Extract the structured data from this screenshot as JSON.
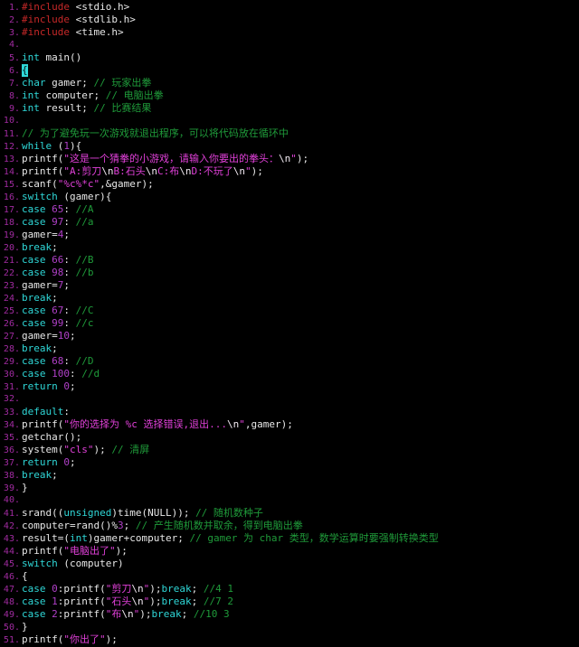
{
  "editor": {
    "name": "code-editor",
    "language": "C",
    "background_color": "#000000",
    "cursor": {
      "line": 6,
      "column": 1,
      "char": "{",
      "color": "#2fd7d7"
    },
    "colors": {
      "keyword": "#2fd7d7",
      "preprocessor": "#c62828",
      "number": "#b040c8",
      "string": "#e040d8",
      "comment": "#1f9b3a",
      "identifier": "#e8e8e8",
      "line_number": "#a02ba0",
      "background": "#000000"
    }
  },
  "lines": [
    {
      "n": "1",
      "tokens": [
        {
          "t": "pre",
          "v": "#include"
        },
        {
          "t": "id",
          "v": " "
        },
        {
          "t": "hdr",
          "v": "<stdio.h>"
        }
      ]
    },
    {
      "n": "2",
      "tokens": [
        {
          "t": "pre",
          "v": "#include"
        },
        {
          "t": "id",
          "v": " "
        },
        {
          "t": "hdr",
          "v": "<stdlib.h>"
        }
      ]
    },
    {
      "n": "3",
      "tokens": [
        {
          "t": "pre",
          "v": "#include"
        },
        {
          "t": "id",
          "v": " "
        },
        {
          "t": "hdr",
          "v": "<time.h>"
        }
      ]
    },
    {
      "n": "4",
      "tokens": []
    },
    {
      "n": "5",
      "tokens": [
        {
          "t": "kw",
          "v": "int"
        },
        {
          "t": "id",
          "v": " main()"
        }
      ]
    },
    {
      "n": "6",
      "tokens": [
        {
          "t": "cursor",
          "v": "{"
        }
      ]
    },
    {
      "n": "7",
      "tokens": [
        {
          "t": "kw",
          "v": "char"
        },
        {
          "t": "id",
          "v": " gamer; "
        },
        {
          "t": "cmt",
          "v": "// 玩家出拳"
        }
      ]
    },
    {
      "n": "8",
      "tokens": [
        {
          "t": "kw",
          "v": "int"
        },
        {
          "t": "id",
          "v": " computer; "
        },
        {
          "t": "cmt",
          "v": "// 电脑出拳"
        }
      ]
    },
    {
      "n": "9",
      "tokens": [
        {
          "t": "kw",
          "v": "int"
        },
        {
          "t": "id",
          "v": " result; "
        },
        {
          "t": "cmt",
          "v": "// 比赛结果"
        }
      ]
    },
    {
      "n": "10",
      "tokens": []
    },
    {
      "n": "11",
      "tokens": [
        {
          "t": "cmt",
          "v": "// 为了避免玩一次游戏就退出程序，可以将代码放在循环中"
        }
      ]
    },
    {
      "n": "12",
      "tokens": [
        {
          "t": "kw",
          "v": "while"
        },
        {
          "t": "id",
          "v": " ("
        },
        {
          "t": "num",
          "v": "1"
        },
        {
          "t": "id",
          "v": "){"
        }
      ]
    },
    {
      "n": "13",
      "tokens": [
        {
          "t": "id",
          "v": "printf("
        },
        {
          "t": "str",
          "v": "\"这是一个猜拳的小游戏，请输入你要出的拳头："
        },
        {
          "t": "esc",
          "v": "\\n"
        },
        {
          "t": "str",
          "v": "\""
        },
        {
          "t": "id",
          "v": ");"
        }
      ]
    },
    {
      "n": "14",
      "tokens": [
        {
          "t": "id",
          "v": "printf("
        },
        {
          "t": "str",
          "v": "\"A:剪刀"
        },
        {
          "t": "esc",
          "v": "\\n"
        },
        {
          "t": "str",
          "v": "B:石头"
        },
        {
          "t": "esc",
          "v": "\\n"
        },
        {
          "t": "str",
          "v": "C:布"
        },
        {
          "t": "esc",
          "v": "\\n"
        },
        {
          "t": "str",
          "v": "D:不玩了"
        },
        {
          "t": "esc",
          "v": "\\n"
        },
        {
          "t": "str",
          "v": "\""
        },
        {
          "t": "id",
          "v": ");"
        }
      ]
    },
    {
      "n": "15",
      "tokens": [
        {
          "t": "id",
          "v": "scanf("
        },
        {
          "t": "str",
          "v": "\"%c%*c\""
        },
        {
          "t": "id",
          "v": ",&gamer);"
        }
      ]
    },
    {
      "n": "16",
      "tokens": [
        {
          "t": "kw",
          "v": "switch"
        },
        {
          "t": "id",
          "v": " (gamer){"
        }
      ]
    },
    {
      "n": "17",
      "tokens": [
        {
          "t": "kw",
          "v": "case"
        },
        {
          "t": "id",
          "v": " "
        },
        {
          "t": "num",
          "v": "65"
        },
        {
          "t": "id",
          "v": ": "
        },
        {
          "t": "cmt",
          "v": "//A"
        }
      ]
    },
    {
      "n": "18",
      "tokens": [
        {
          "t": "kw",
          "v": "case"
        },
        {
          "t": "id",
          "v": " "
        },
        {
          "t": "num",
          "v": "97"
        },
        {
          "t": "id",
          "v": ": "
        },
        {
          "t": "cmt",
          "v": "//a"
        }
      ]
    },
    {
      "n": "19",
      "tokens": [
        {
          "t": "id",
          "v": "gamer="
        },
        {
          "t": "num",
          "v": "4"
        },
        {
          "t": "id",
          "v": ";"
        }
      ]
    },
    {
      "n": "20",
      "tokens": [
        {
          "t": "kw",
          "v": "break"
        },
        {
          "t": "id",
          "v": ";"
        }
      ]
    },
    {
      "n": "21",
      "tokens": [
        {
          "t": "kw",
          "v": "case"
        },
        {
          "t": "id",
          "v": " "
        },
        {
          "t": "num",
          "v": "66"
        },
        {
          "t": "id",
          "v": ": "
        },
        {
          "t": "cmt",
          "v": "//B"
        }
      ]
    },
    {
      "n": "22",
      "tokens": [
        {
          "t": "kw",
          "v": "case"
        },
        {
          "t": "id",
          "v": " "
        },
        {
          "t": "num",
          "v": "98"
        },
        {
          "t": "id",
          "v": ": "
        },
        {
          "t": "cmt",
          "v": "//b"
        }
      ]
    },
    {
      "n": "23",
      "tokens": [
        {
          "t": "id",
          "v": "gamer="
        },
        {
          "t": "num",
          "v": "7"
        },
        {
          "t": "id",
          "v": ";"
        }
      ]
    },
    {
      "n": "24",
      "tokens": [
        {
          "t": "kw",
          "v": "break"
        },
        {
          "t": "id",
          "v": ";"
        }
      ]
    },
    {
      "n": "25",
      "tokens": [
        {
          "t": "kw",
          "v": "case"
        },
        {
          "t": "id",
          "v": " "
        },
        {
          "t": "num",
          "v": "67"
        },
        {
          "t": "id",
          "v": ": "
        },
        {
          "t": "cmt",
          "v": "//C"
        }
      ]
    },
    {
      "n": "26",
      "tokens": [
        {
          "t": "kw",
          "v": "case"
        },
        {
          "t": "id",
          "v": " "
        },
        {
          "t": "num",
          "v": "99"
        },
        {
          "t": "id",
          "v": ": "
        },
        {
          "t": "cmt",
          "v": "//c"
        }
      ]
    },
    {
      "n": "27",
      "tokens": [
        {
          "t": "id",
          "v": "gamer="
        },
        {
          "t": "num",
          "v": "10"
        },
        {
          "t": "id",
          "v": ";"
        }
      ]
    },
    {
      "n": "28",
      "tokens": [
        {
          "t": "kw",
          "v": "break"
        },
        {
          "t": "id",
          "v": ";"
        }
      ]
    },
    {
      "n": "29",
      "tokens": [
        {
          "t": "kw",
          "v": "case"
        },
        {
          "t": "id",
          "v": " "
        },
        {
          "t": "num",
          "v": "68"
        },
        {
          "t": "id",
          "v": ": "
        },
        {
          "t": "cmt",
          "v": "//D"
        }
      ]
    },
    {
      "n": "30",
      "tokens": [
        {
          "t": "kw",
          "v": "case"
        },
        {
          "t": "id",
          "v": " "
        },
        {
          "t": "num",
          "v": "100"
        },
        {
          "t": "id",
          "v": ": "
        },
        {
          "t": "cmt",
          "v": "//d"
        }
      ]
    },
    {
      "n": "31",
      "tokens": [
        {
          "t": "kw",
          "v": "return"
        },
        {
          "t": "id",
          "v": " "
        },
        {
          "t": "num",
          "v": "0"
        },
        {
          "t": "id",
          "v": ";"
        }
      ]
    },
    {
      "n": "32",
      "tokens": []
    },
    {
      "n": "33",
      "tokens": [
        {
          "t": "kw",
          "v": "default"
        },
        {
          "t": "id",
          "v": ":"
        }
      ]
    },
    {
      "n": "34",
      "tokens": [
        {
          "t": "id",
          "v": "printf("
        },
        {
          "t": "str",
          "v": "\"你的选择为 %c 选择错误,退出..."
        },
        {
          "t": "esc",
          "v": "\\n"
        },
        {
          "t": "str",
          "v": "\""
        },
        {
          "t": "id",
          "v": ",gamer);"
        }
      ]
    },
    {
      "n": "35",
      "tokens": [
        {
          "t": "id",
          "v": "getchar();"
        }
      ]
    },
    {
      "n": "36",
      "tokens": [
        {
          "t": "id",
          "v": "system("
        },
        {
          "t": "str",
          "v": "\"cls\""
        },
        {
          "t": "id",
          "v": "); "
        },
        {
          "t": "cmt",
          "v": "// 清屏"
        }
      ]
    },
    {
      "n": "37",
      "tokens": [
        {
          "t": "kw",
          "v": "return"
        },
        {
          "t": "id",
          "v": " "
        },
        {
          "t": "num",
          "v": "0"
        },
        {
          "t": "id",
          "v": ";"
        }
      ]
    },
    {
      "n": "38",
      "tokens": [
        {
          "t": "kw",
          "v": "break"
        },
        {
          "t": "id",
          "v": ";"
        }
      ]
    },
    {
      "n": "39",
      "tokens": [
        {
          "t": "id",
          "v": "}"
        }
      ]
    },
    {
      "n": "40",
      "tokens": []
    },
    {
      "n": "41",
      "tokens": [
        {
          "t": "id",
          "v": "srand(("
        },
        {
          "t": "kw",
          "v": "unsigned"
        },
        {
          "t": "id",
          "v": ")time(NULL)); "
        },
        {
          "t": "cmt",
          "v": "// 随机数种子"
        }
      ]
    },
    {
      "n": "42",
      "tokens": [
        {
          "t": "id",
          "v": "computer=rand()%"
        },
        {
          "t": "num",
          "v": "3"
        },
        {
          "t": "id",
          "v": "; "
        },
        {
          "t": "cmt",
          "v": "// 产生随机数并取余，得到电脑出拳"
        }
      ]
    },
    {
      "n": "43",
      "tokens": [
        {
          "t": "id",
          "v": "result=("
        },
        {
          "t": "kw",
          "v": "int"
        },
        {
          "t": "id",
          "v": ")gamer+computer; "
        },
        {
          "t": "cmt",
          "v": "// gamer 为 char 类型，数学运算时要强制转换类型"
        }
      ]
    },
    {
      "n": "44",
      "tokens": [
        {
          "t": "id",
          "v": "printf("
        },
        {
          "t": "str",
          "v": "\"电脑出了\""
        },
        {
          "t": "id",
          "v": ");"
        }
      ]
    },
    {
      "n": "45",
      "tokens": [
        {
          "t": "kw",
          "v": "switch"
        },
        {
          "t": "id",
          "v": " (computer)"
        }
      ]
    },
    {
      "n": "46",
      "tokens": [
        {
          "t": "id",
          "v": "{"
        }
      ]
    },
    {
      "n": "47",
      "tokens": [
        {
          "t": "kw",
          "v": "case"
        },
        {
          "t": "id",
          "v": " "
        },
        {
          "t": "num",
          "v": "0"
        },
        {
          "t": "id",
          "v": ":printf("
        },
        {
          "t": "str",
          "v": "\"剪刀"
        },
        {
          "t": "esc",
          "v": "\\n"
        },
        {
          "t": "str",
          "v": "\""
        },
        {
          "t": "id",
          "v": ");"
        },
        {
          "t": "kw",
          "v": "break"
        },
        {
          "t": "id",
          "v": "; "
        },
        {
          "t": "cmt",
          "v": "//4 1"
        }
      ]
    },
    {
      "n": "48",
      "tokens": [
        {
          "t": "kw",
          "v": "case"
        },
        {
          "t": "id",
          "v": " "
        },
        {
          "t": "num",
          "v": "1"
        },
        {
          "t": "id",
          "v": ":printf("
        },
        {
          "t": "str",
          "v": "\"石头"
        },
        {
          "t": "esc",
          "v": "\\n"
        },
        {
          "t": "str",
          "v": "\""
        },
        {
          "t": "id",
          "v": ");"
        },
        {
          "t": "kw",
          "v": "break"
        },
        {
          "t": "id",
          "v": "; "
        },
        {
          "t": "cmt",
          "v": "//7 2"
        }
      ]
    },
    {
      "n": "49",
      "tokens": [
        {
          "t": "kw",
          "v": "case"
        },
        {
          "t": "id",
          "v": " "
        },
        {
          "t": "num",
          "v": "2"
        },
        {
          "t": "id",
          "v": ":printf("
        },
        {
          "t": "str",
          "v": "\"布"
        },
        {
          "t": "esc",
          "v": "\\n"
        },
        {
          "t": "str",
          "v": "\""
        },
        {
          "t": "id",
          "v": ");"
        },
        {
          "t": "kw",
          "v": "break"
        },
        {
          "t": "id",
          "v": "; "
        },
        {
          "t": "cmt",
          "v": "//10 3"
        }
      ]
    },
    {
      "n": "50",
      "tokens": [
        {
          "t": "id",
          "v": "}"
        }
      ]
    },
    {
      "n": "51",
      "tokens": [
        {
          "t": "id",
          "v": "printf("
        },
        {
          "t": "str",
          "v": "\"你出了\""
        },
        {
          "t": "id",
          "v": ");"
        }
      ]
    }
  ]
}
